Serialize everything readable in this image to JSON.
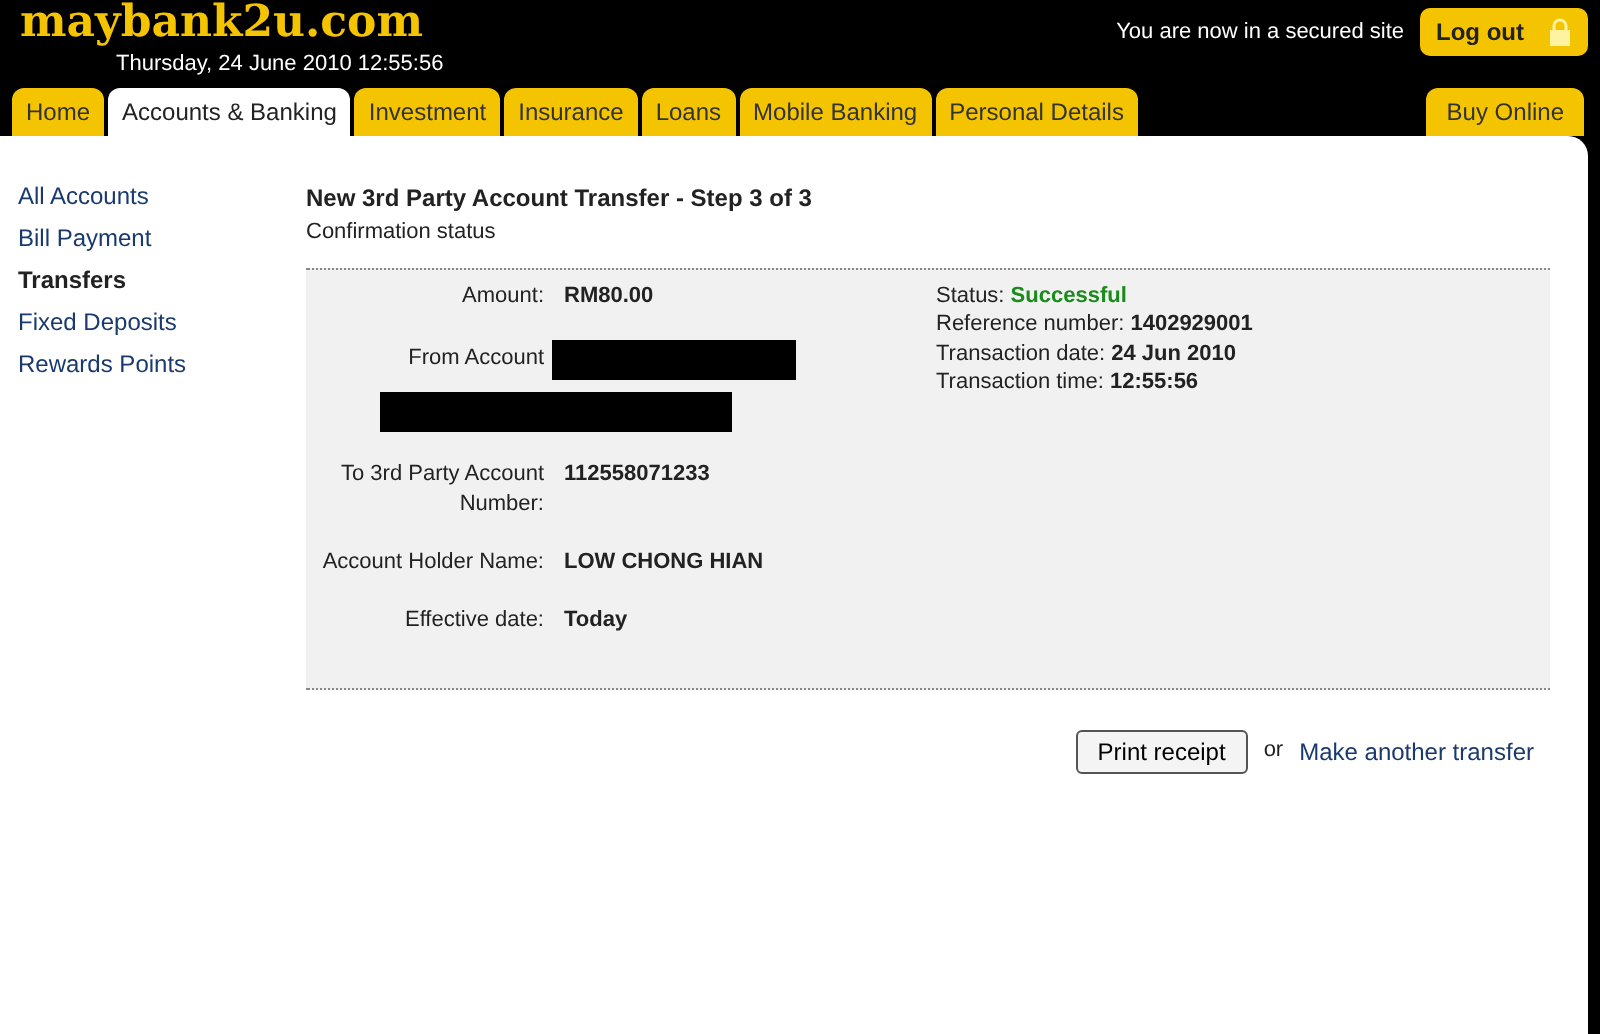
{
  "header": {
    "logo": "maybank2u.com",
    "datetime": "Thursday, 24 June 2010 12:55:56",
    "secure_note": "You are now in a secured site",
    "logout": "Log out"
  },
  "tabs": [
    {
      "label": "Home",
      "selected": false
    },
    {
      "label": "Accounts & Banking",
      "selected": true
    },
    {
      "label": "Investment",
      "selected": false
    },
    {
      "label": "Insurance",
      "selected": false
    },
    {
      "label": "Loans",
      "selected": false
    },
    {
      "label": "Mobile Banking",
      "selected": false
    },
    {
      "label": "Personal Details",
      "selected": false
    }
  ],
  "buy_online": "Buy Online",
  "sidebar": [
    {
      "label": "All Accounts",
      "selected": false
    },
    {
      "label": "Bill Payment",
      "selected": false
    },
    {
      "label": "Transfers",
      "selected": true
    },
    {
      "label": "Fixed Deposits",
      "selected": false
    },
    {
      "label": "Rewards Points",
      "selected": false
    }
  ],
  "title": "New 3rd Party Account Transfer - Step 3 of 3",
  "subtitle": "Confirmation status",
  "details": [
    {
      "label": "Amount:",
      "value": "RM80.00",
      "kind": "text"
    },
    {
      "label": "From Account",
      "kind": "redacted"
    },
    {
      "kind": "redacted_line"
    },
    {
      "label": "To 3rd Party Account Number:",
      "value": "112558071233",
      "kind": "text"
    },
    {
      "label": "Account Holder Name:",
      "value": "LOW CHONG HIAN",
      "kind": "text"
    },
    {
      "label": "Effective date:",
      "value": "Today",
      "kind": "text"
    }
  ],
  "status": [
    {
      "label": "Status:",
      "value": "Successful",
      "kind": "success"
    },
    {
      "label": "Reference number:",
      "value": "1402929001",
      "kind": "text"
    },
    {
      "label": "Transaction date:",
      "value": "24 Jun 2010",
      "kind": "text"
    },
    {
      "label": "Transaction time:",
      "value": "12:55:56",
      "kind": "text"
    }
  ],
  "actions": {
    "print": "Print receipt",
    "separator": "or",
    "link": "Make another transfer"
  }
}
